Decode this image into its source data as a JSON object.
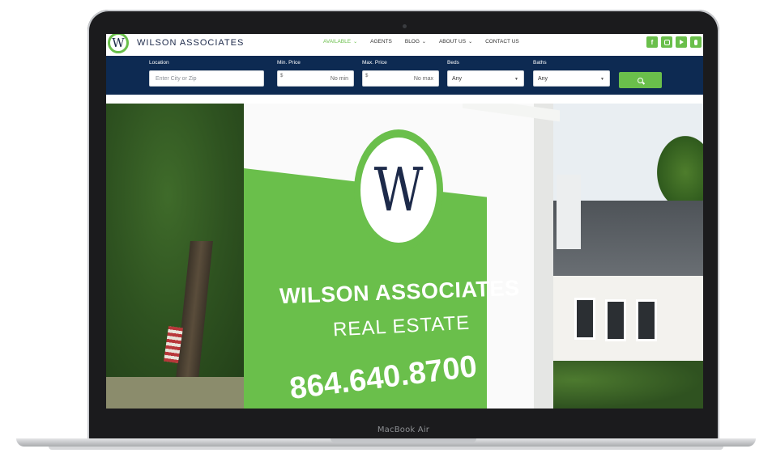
{
  "device": {
    "label": "MacBook Air"
  },
  "header": {
    "logo_letter": "W",
    "brand": "WILSON ASSOCIATES",
    "nav": [
      {
        "label": "AVAILABLE",
        "active": true,
        "dropdown": true
      },
      {
        "label": "AGENTS",
        "active": false,
        "dropdown": false
      },
      {
        "label": "BLOG",
        "active": false,
        "dropdown": true
      },
      {
        "label": "ABOUT US",
        "active": false,
        "dropdown": true
      },
      {
        "label": "CONTACT US",
        "active": false,
        "dropdown": false
      }
    ],
    "social_icons": [
      "facebook-icon",
      "instagram-icon",
      "youtube-icon",
      "podcast-icon"
    ]
  },
  "search": {
    "location": {
      "label": "Location",
      "placeholder": "Enter City or Zip"
    },
    "min_price": {
      "label": "Min. Price",
      "currency": "$",
      "value": "No min"
    },
    "max_price": {
      "label": "Max. Price",
      "currency": "$",
      "value": "No max"
    },
    "beds": {
      "label": "Beds",
      "selected": "Any"
    },
    "baths": {
      "label": "Baths",
      "selected": "Any"
    },
    "button_icon": "search-icon"
  },
  "hero": {
    "sign_letter": "W",
    "sign_line1": "WILSON ASSOCIATES",
    "sign_line2": "REAL ESTATE",
    "sign_phone": "864.640.8700"
  },
  "colors": {
    "brand_green": "#6abf4b",
    "navy": "#0d2a52",
    "logo_navy": "#1d2a4a"
  }
}
